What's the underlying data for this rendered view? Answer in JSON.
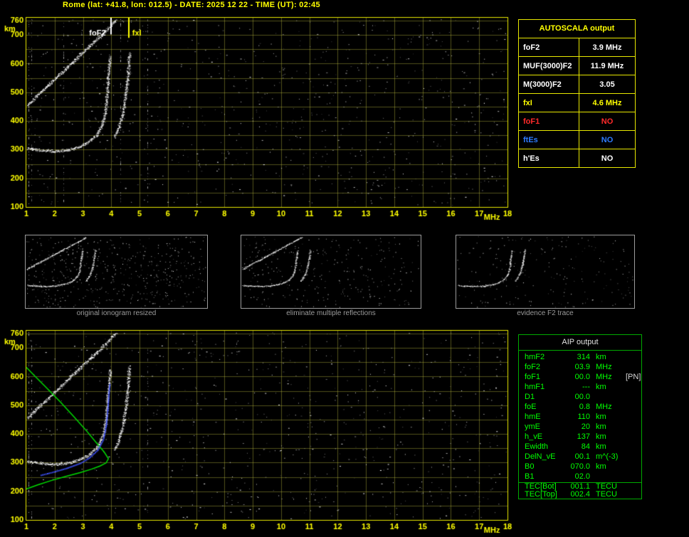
{
  "title": "Rome (lat: +41.8, lon: 012.5) - DATE: 2025 12 22 - TIME (UT): 02:45",
  "colors": {
    "accent_yellow": "#ffff00",
    "trace_white": "#ffffff",
    "profile_green": "#00dc00",
    "fitted_blue": "#4054ff",
    "alert_red": "#ff2a2a",
    "info_blue": "#2e7bff",
    "aip_green": "#00ff00",
    "caption_gray": "#9a9a9a"
  },
  "autoscala_table": {
    "header": "AUTOSCALA output",
    "rows": [
      {
        "label": "foF2",
        "value": "3.9 MHz",
        "color": "#ffffff"
      },
      {
        "label": "MUF(3000)F2",
        "value": "11.9 MHz",
        "color": "#ffffff"
      },
      {
        "label": "M(3000)F2",
        "value": "3.05",
        "color": "#ffffff"
      },
      {
        "label": "fxI",
        "value": "4.6 MHz",
        "color": "#ffff00"
      },
      {
        "label": "foF1",
        "value": "NO",
        "color": "#ff2a2a"
      },
      {
        "label": "ftEs",
        "value": "NO",
        "color": "#2e7bff"
      },
      {
        "label": "h'Es",
        "value": "NO",
        "color": "#ffffff"
      }
    ]
  },
  "aip_table": {
    "header": "AIP output",
    "rows": [
      {
        "label": "hmF2",
        "value": "314",
        "unit": "km",
        "note": ""
      },
      {
        "label": "foF2",
        "value": "03.9",
        "unit": "MHz",
        "note": ""
      },
      {
        "label": "foF1",
        "value": "00.0",
        "unit": "MHz",
        "note": "[PN]"
      },
      {
        "label": "hmF1",
        "value": "---",
        "unit": "km",
        "note": ""
      },
      {
        "label": "D1",
        "value": "00.0",
        "unit": "",
        "note": ""
      },
      {
        "label": "foE",
        "value": "0.8",
        "unit": "MHz",
        "note": ""
      },
      {
        "label": "hmE",
        "value": "110",
        "unit": "km",
        "note": ""
      },
      {
        "label": "ymE",
        "value": "20",
        "unit": "km",
        "note": ""
      },
      {
        "label": "h_vE",
        "value": "137",
        "unit": "km",
        "note": ""
      },
      {
        "label": "Ewidth",
        "value": "84",
        "unit": "km",
        "note": ""
      },
      {
        "label": "DelN_vE",
        "value": "00.1",
        "unit": "m^(-3)",
        "note": ""
      },
      {
        "label": "B0",
        "value": "070.0",
        "unit": "km",
        "note": ""
      },
      {
        "label": "B1",
        "value": "02.0",
        "unit": "",
        "note": ""
      }
    ],
    "tec_rows": [
      {
        "label": "TEC[Bot]",
        "value": "001.1",
        "unit": "TECU"
      },
      {
        "label": "TEC[Top]",
        "value": "002.4",
        "unit": "TECU"
      }
    ]
  },
  "thumbnails": [
    {
      "caption": "original ionogram resized"
    },
    {
      "caption": "eliminate multiple reflections"
    },
    {
      "caption": "evidence F2 trace"
    }
  ],
  "chart_data": [
    {
      "type": "scatter",
      "name": "main ionogram with autoscaled characteristics",
      "xlabel": "MHz",
      "ylabel": "km",
      "xlim": [
        1,
        18
      ],
      "ylim": [
        100,
        760
      ],
      "xticks": [
        1,
        2,
        3,
        4,
        5,
        6,
        7,
        8,
        9,
        10,
        11,
        12,
        13,
        14,
        15,
        16,
        17,
        18
      ],
      "yticks": [
        760,
        700,
        600,
        500,
        400,
        300,
        200,
        100
      ],
      "grid": {
        "x_step_mhz": 1,
        "y_step_km": 50,
        "on": true
      },
      "scaled": {
        "foF2_MHz": 3.9,
        "MUF3000F2_MHz": 11.9,
        "M3000F2": 3.05,
        "fxI_MHz": 4.6
      },
      "annotations": [
        {
          "type": "label",
          "text": "foF2",
          "x": 3.22,
          "y": 706,
          "color": "#ffffff"
        },
        {
          "type": "label",
          "text": "fxI",
          "x": 4.74,
          "y": 706,
          "color": "#ffff00"
        },
        {
          "type": "vline",
          "x": 4.6,
          "from": 760,
          "to": 690,
          "color": "#ffff00"
        },
        {
          "type": "vline",
          "x": 3.98,
          "from": 760,
          "to": 702,
          "color": "#ffffff"
        }
      ],
      "traces": [
        {
          "name": "F2-o-mode-trace",
          "points": [
            [
              1.0,
              306
            ],
            [
              1.5,
              298
            ],
            [
              2.0,
              295
            ],
            [
              2.5,
              300
            ],
            [
              2.9,
              312
            ],
            [
              3.2,
              327
            ],
            [
              3.5,
              355
            ],
            [
              3.7,
              395
            ],
            [
              3.8,
              445
            ],
            [
              3.85,
              505
            ],
            [
              3.9,
              570
            ],
            [
              3.95,
              625
            ]
          ]
        },
        {
          "name": "second-reflection",
          "points": [
            [
              1.0,
              452
            ],
            [
              1.4,
              492
            ],
            [
              1.9,
              537
            ],
            [
              2.4,
              585
            ],
            [
              2.9,
              632
            ],
            [
              3.4,
              678
            ],
            [
              3.8,
              715
            ],
            [
              4.15,
              752
            ]
          ]
        },
        {
          "name": "x-mode-cusp",
          "points": [
            [
              4.12,
              345
            ],
            [
              4.25,
              375
            ],
            [
              4.4,
              425
            ],
            [
              4.5,
              490
            ],
            [
              4.58,
              565
            ],
            [
              4.63,
              635
            ]
          ]
        }
      ]
    },
    {
      "type": "scatter",
      "name": "ionogram with fitted trace and electron density profile",
      "xlabel": "MHz",
      "ylabel": "km",
      "xlim": [
        1,
        18
      ],
      "ylim": [
        100,
        760
      ],
      "xticks": [
        1,
        2,
        3,
        4,
        5,
        6,
        7,
        8,
        9,
        10,
        11,
        12,
        13,
        14,
        15,
        16,
        17,
        18
      ],
      "yticks": [
        760,
        700,
        600,
        500,
        400,
        300,
        200,
        100
      ],
      "grid": {
        "x_step_mhz": 1,
        "y_step_km": 50,
        "on": true
      },
      "annotations": [],
      "traces": [
        {
          "name": "F2-o-mode-trace",
          "points": [
            [
              1.0,
              306
            ],
            [
              1.5,
              298
            ],
            [
              2.0,
              295
            ],
            [
              2.5,
              300
            ],
            [
              2.9,
              312
            ],
            [
              3.2,
              327
            ],
            [
              3.5,
              355
            ],
            [
              3.7,
              395
            ],
            [
              3.8,
              445
            ],
            [
              3.85,
              505
            ],
            [
              3.9,
              570
            ],
            [
              3.95,
              625
            ]
          ]
        },
        {
          "name": "second-reflection",
          "points": [
            [
              1.0,
              452
            ],
            [
              1.4,
              492
            ],
            [
              1.9,
              537
            ],
            [
              2.4,
              585
            ],
            [
              2.9,
              632
            ],
            [
              3.4,
              678
            ],
            [
              3.8,
              715
            ],
            [
              4.15,
              752
            ]
          ]
        },
        {
          "name": "x-mode-cusp",
          "points": [
            [
              4.12,
              345
            ],
            [
              4.25,
              375
            ],
            [
              4.4,
              425
            ],
            [
              4.5,
              490
            ],
            [
              4.58,
              565
            ],
            [
              4.63,
              635
            ]
          ]
        }
      ],
      "profile_green": [
        [
          1.0,
          632
        ],
        [
          1.3,
          602
        ],
        [
          1.7,
          562
        ],
        [
          2.2,
          512
        ],
        [
          2.7,
          458
        ],
        [
          3.15,
          408
        ],
        [
          3.5,
          366
        ],
        [
          3.75,
          337
        ],
        [
          3.9,
          314
        ],
        [
          3.82,
          299
        ],
        [
          3.6,
          288
        ],
        [
          3.3,
          277
        ],
        [
          2.9,
          265
        ],
        [
          2.4,
          252
        ],
        [
          1.9,
          238
        ],
        [
          1.4,
          222
        ],
        [
          1.0,
          208
        ]
      ],
      "fitted_trace_blue": [
        [
          1.5,
          258
        ],
        [
          1.9,
          268
        ],
        [
          2.4,
          282
        ],
        [
          2.9,
          300
        ],
        [
          3.2,
          318
        ],
        [
          3.5,
          345
        ],
        [
          3.7,
          382
        ],
        [
          3.8,
          430
        ],
        [
          3.86,
          490
        ],
        [
          3.9,
          548
        ],
        [
          3.93,
          580
        ]
      ]
    }
  ]
}
